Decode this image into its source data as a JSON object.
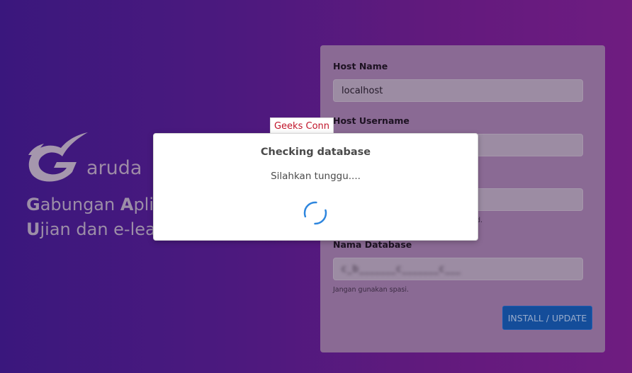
{
  "brand": {
    "name": "aruda",
    "tagline_line1": [
      {
        "text": "G",
        "bold": true
      },
      {
        "text": "abungan ",
        "bold": false
      },
      {
        "text": "A",
        "bold": true
      },
      {
        "text": "plik",
        "bold": false
      }
    ],
    "tagline_line2": [
      {
        "text": "U",
        "bold": true
      },
      {
        "text": "jian dan e-lear",
        "bold": false
      }
    ]
  },
  "form": {
    "host_name_label": "Host Name",
    "host_name_value": "localhost",
    "host_username_label": "Host Username",
    "password_hint_visible": "d.",
    "db_name_label": "Nama Database",
    "db_name_value": "c_b_______c_______c___",
    "db_name_hint": "Jangan gunakan spasi.",
    "install_button": "INSTALL / UPDATE"
  },
  "tooltip": {
    "text": "Geeks Conn"
  },
  "modal": {
    "title": "Checking database",
    "message": "Silahkan tunggu...."
  },
  "colors": {
    "spinner": "#2e86de",
    "button": "#144d9a",
    "tooltip_text": "#c0142a"
  }
}
